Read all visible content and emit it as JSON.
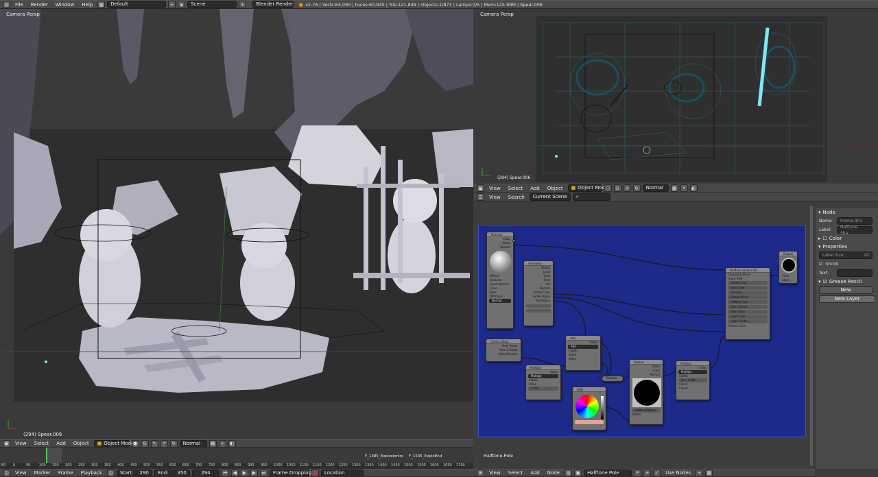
{
  "top_bar": {
    "menus": [
      "File",
      "Render",
      "Window",
      "Help"
    ],
    "layout": "Default",
    "scene": "Scene",
    "engine": "Blender Render",
    "stats": "v2.76 | Verts:64,090 | Faces:60,940 | Tris:121,849 | Objects:1/871 | Lamps:0/5 | Mem:125.99M | Spear.006"
  },
  "viewport_left": {
    "label": "Camera Persp",
    "object_info": "(294) Spear.006",
    "header": {
      "menus": [
        "View",
        "Select",
        "Add",
        "Object"
      ],
      "mode": "Object Mode",
      "pivot": "Normal"
    }
  },
  "viewport_right": {
    "label": "Camera Persp",
    "object_info": "(294) Spear.006",
    "header": {
      "menus": [
        "View",
        "Select",
        "Add",
        "Object"
      ],
      "mode": "Object Mode",
      "pivot": "Normal"
    }
  },
  "outliner": {
    "menus": [
      "View",
      "Search"
    ],
    "scope": "Current Scene"
  },
  "node_editor": {
    "footer_label": "Halftone.Pole",
    "header": {
      "menus": [
        "View",
        "Select",
        "Add",
        "Node"
      ],
      "tree": "Halftone Pole",
      "use_nodes": "Use Nodes"
    },
    "nodes": {
      "material": {
        "title": "Material",
        "rows": [
          "Color",
          "Alpha",
          "Normal"
        ],
        "opts": [
          "Diffuse",
          "Specular",
          "Invert Normal"
        ],
        "inputs": [
          "Color",
          "Spec",
          "DiffIntens"
        ],
        "mode": "Normal"
      },
      "geometry": {
        "title": "Geometry",
        "rows": [
          "Global",
          "Local",
          "View",
          "Orco",
          "UV",
          "Normal",
          "Vertex Color",
          "Vertex Alpha",
          "Front/Back"
        ]
      },
      "camera_data": {
        "title": "Camera Data",
        "rows": [
          "View Vector",
          "View Z Depth",
          "View Distance"
        ]
      },
      "add": {
        "title": "Add",
        "mode": "Add",
        "clamp": "Clamp",
        "inputs": [
          "Value",
          "Value"
        ]
      },
      "multiply": {
        "title": "Multiply",
        "mode": "Multiply",
        "clamp": "Clamp",
        "inputs": [
          "Value",
          "Value"
        ],
        "val": "0.050"
      },
      "rgb": {
        "title": "RGB"
      },
      "reroute": {
        "title": "Reroute"
      },
      "texture": {
        "title": "Texture",
        "rows": [
          "Value",
          "Color",
          "Normal"
        ],
        "tex": "HalftonePattern",
        "vector": "Vector"
      },
      "multiply2": {
        "title": "Multiply",
        "mode": "Multiply",
        "clamp": "Clamp",
        "fac": "Fac: 1.000",
        "inputs": [
          "Color1",
          "Color2"
        ]
      },
      "group": {
        "title": "Halftone Shader.001",
        "rows": [
          "Output/Halftone",
          "Input RGB",
          "Offset Color",
          "Spot Color",
          "Dot Size",
          "Rotate Blend",
          "Halftone Res",
          "Dark Limiter",
          "Dark Color",
          "Light Color",
          "Light Limiter",
          "Diffuse Color"
        ]
      },
      "output": {
        "title": "Output",
        "rows": [
          "Color",
          "Alpha"
        ]
      }
    }
  },
  "properties": {
    "node_panel": "Node",
    "name_label": "Name:",
    "name_value": "Frame.001",
    "label_label": "Label:",
    "label_value": "Halftone Sha...",
    "color": "Color",
    "props": "Properties",
    "label_size_label": "Label Size:",
    "label_size_value": "20",
    "shrink": "Shrink",
    "text_label": "Text:",
    "grease_pencil": "Grease Pencil",
    "new_btn": "New",
    "new_layer": "New Layer"
  },
  "timeline": {
    "menus": [
      "View",
      "Marker",
      "Frame",
      "Playback"
    ],
    "start_label": "Start:",
    "start": "290",
    "end_label": "End:",
    "end": "350",
    "current": "294",
    "sync": "Frame Dropping",
    "keying": "Location",
    "ticks": [
      "-50",
      "0",
      "50",
      "100",
      "150",
      "200",
      "250",
      "300",
      "350",
      "400",
      "450",
      "500",
      "550",
      "600",
      "650",
      "700",
      "750",
      "800",
      "850",
      "900",
      "950",
      "1000",
      "1050",
      "1100",
      "1150",
      "1200",
      "1250",
      "1300",
      "1350",
      "1400",
      "1450",
      "1500",
      "1550",
      "1600",
      "1650",
      "1700"
    ],
    "markers": [
      "F_1385_ExplosionIni",
      "F_1535_ExploEnd"
    ]
  },
  "colors": {
    "node_bg": "#1e2a8a",
    "viewport_bg": "#3a3a3a",
    "accent_orange": "#e8a020",
    "socket_yellow": "#d8d038",
    "socket_gray": "#a0a0a0"
  }
}
